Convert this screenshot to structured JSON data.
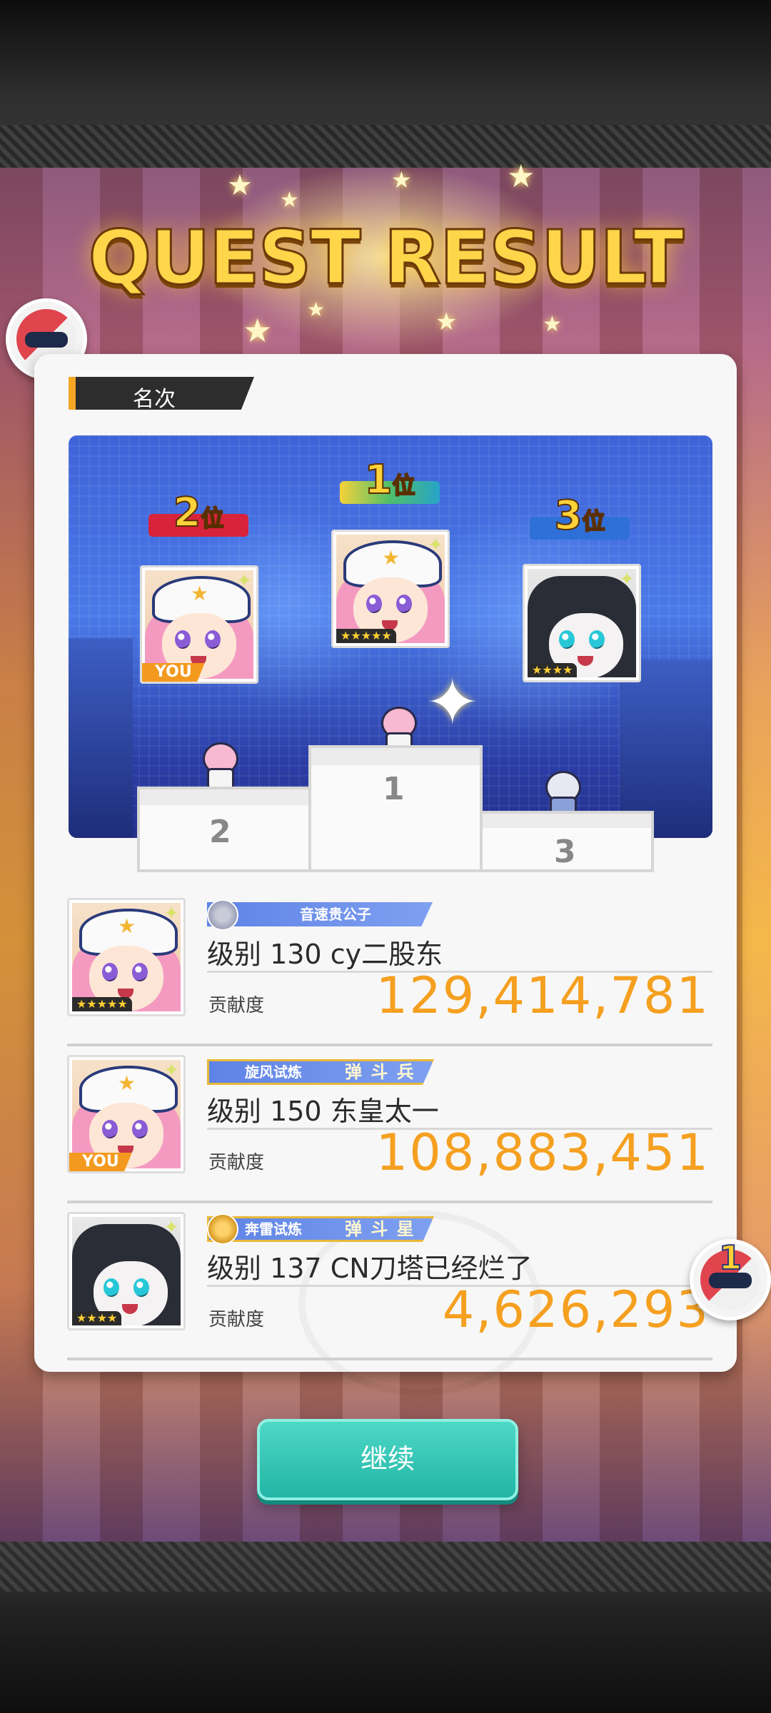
{
  "header": {
    "title": "QUEST RESULT"
  },
  "section": {
    "label": "名次"
  },
  "podium": {
    "first": {
      "rank_number": "1",
      "rank_suffix": "位",
      "stars": "★★★★★",
      "platform_number": "1"
    },
    "second": {
      "rank_number": "2",
      "rank_suffix": "位",
      "tag": "YOU",
      "platform_number": "2"
    },
    "third": {
      "rank_number": "3",
      "rank_suffix": "位",
      "stars": "★★★★",
      "platform_number": "3"
    }
  },
  "rankings": [
    {
      "title_badge": "音速贵公子",
      "title_sub": "",
      "player": "级别 130 cy二股东",
      "contrib_label": "贡献度",
      "contrib_value": "129,414,781",
      "stars": "★★★★★"
    },
    {
      "title_badge": "旋风试炼",
      "title_sub": "弹 斗 兵",
      "player": "级别 150 东皇太一",
      "contrib_label": "贡献度",
      "contrib_value": "108,883,451",
      "tag": "YOU"
    },
    {
      "title_badge": "奔雷试炼",
      "title_sub": "弹 斗 星",
      "player": "级别 137 CN刀塔已经烂了",
      "contrib_label": "贡献度",
      "contrib_value": "4,626,293",
      "stars": "★★★★"
    }
  ],
  "side_badge": {
    "count": "1"
  },
  "actions": {
    "continue_label": "继续"
  },
  "colors": {
    "accent_orange": "#f5a020",
    "button_teal": "#2fc4b4",
    "title_gold": "#ffd54a"
  }
}
